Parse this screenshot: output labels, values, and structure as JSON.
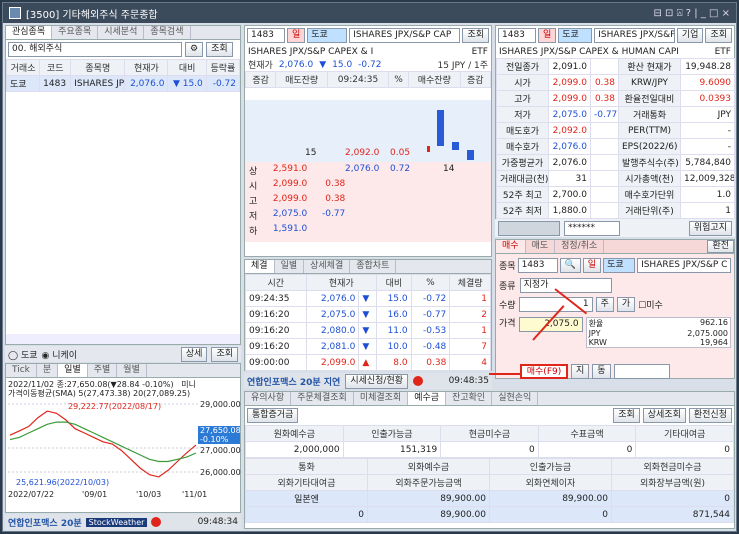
{
  "app": {
    "title": "[3500] 기타해외주식 주문종합",
    "controls": "⊟ ⊡ ⍓ ? | _ □ ×"
  },
  "left": {
    "tabs": [
      "관심종목",
      "주요종목",
      "시세분석",
      "종목검색"
    ],
    "group": "00. 해외주식",
    "search_btn": "조회",
    "cols": [
      "거래소",
      "코드",
      "종목명",
      "현재가",
      "대비",
      "등락률"
    ],
    "rows": [
      {
        "exch": "도쿄",
        "code": "1483",
        "name": "ISHARES JPX/",
        "price": "2,076.0",
        "dir": "▼",
        "diff": "15.0",
        "rate": "-0.72"
      }
    ],
    "radio1": "도쿄",
    "radio2": "니케이",
    "btn_detail": "상세",
    "btn_query": "조회",
    "chart_tabs": [
      "Tick",
      "분",
      "일별",
      "주별",
      "월별"
    ],
    "chart_info1": "2022/11/02 종:27,650.08(▼28.84 -0.10%)",
    "chart_info2": "가격이동평균(SMA) 5(27,473.38) 20(27,089.25)",
    "chart_high": "29,222.77(2022/08/17)",
    "chart_low": "25,621.96(2022/10/03)",
    "yticks": [
      "29,000.00",
      "27,000.00",
      "26,000.00"
    ],
    "ybox1": "27,650.08",
    "ybox2": "-0.10%",
    "xticks": [
      "2022/07/22",
      "'09/01",
      "'10/03",
      "'11/01"
    ],
    "chart_legend": "미니",
    "footer_brand": "연합인포맥스 20분",
    "footer_weather": "StockWeather",
    "footer_time": "09:48:34"
  },
  "chart_data": {
    "type": "line",
    "title": "가격이동평균(SMA)",
    "series": [
      {
        "name": "5",
        "values": [
          27900,
          28100,
          28300,
          28700,
          29000,
          28900,
          28600,
          28200,
          28000,
          27800,
          27600,
          27500,
          27200,
          26800,
          26400,
          26100,
          26000,
          26300,
          26700,
          27100,
          27450
        ]
      },
      {
        "name": "20",
        "values": [
          27700,
          27800,
          28000,
          28200,
          28400,
          28500,
          28500,
          28400,
          28200,
          28000,
          27800,
          27600,
          27400,
          27200,
          27000,
          26800,
          26700,
          26700,
          26800,
          26900,
          27090
        ]
      }
    ],
    "ylim": [
      25400,
      29600
    ]
  },
  "mid": {
    "code": "1483",
    "sell": "일",
    "exch": "도쿄",
    "name": "ISHARES JPX/S&P CAP",
    "btn": "조회",
    "fullname": "ISHARES JPX/S&P CAPEX & I",
    "etf": "ETF",
    "cur_label": "현재가",
    "cur_price": "2,076.0",
    "cur_dir": "▼",
    "cur_diff": "15.0",
    "cur_rate": "-0.72",
    "unit": "15 JPY / 1주",
    "hdr": [
      "증감",
      "매도잔량",
      "09:24:35",
      "%",
      "매수잔량",
      "증감"
    ],
    "ask_qty": "15",
    "ask_price": "2,092.0",
    "ask_rate": "0.05",
    "bid_price": "2,076.0",
    "bid_rate": "0.72",
    "bid_qty": "14",
    "stats": [
      {
        "k": "상",
        "v": "2,591.0",
        "r": ""
      },
      {
        "k": "시",
        "v": "2,099.0",
        "r": "0.38"
      },
      {
        "k": "고",
        "v": "2,099.0",
        "r": "0.38"
      },
      {
        "k": "저",
        "v": "2,075.0",
        "r": "-0.77"
      },
      {
        "k": "하",
        "v": "1,591.0",
        "r": ""
      }
    ],
    "ticks_tabs": [
      "체결",
      "일별",
      "상세체결",
      "종합차트"
    ],
    "tick_cols": [
      "시간",
      "현재가",
      "",
      "대비",
      "%",
      "체결량"
    ],
    "tick_rows": [
      {
        "t": "09:24:35",
        "p": "2,076.0",
        "d": "▼",
        "v": "15.0",
        "r": "-0.72",
        "q": "1"
      },
      {
        "t": "09:16:20",
        "p": "2,075.0",
        "d": "▼",
        "v": "16.0",
        "r": "-0.77",
        "q": "2"
      },
      {
        "t": "09:16:20",
        "p": "2,080.0",
        "d": "▼",
        "v": "11.0",
        "r": "-0.53",
        "q": "1"
      },
      {
        "t": "09:16:20",
        "p": "2,081.0",
        "d": "▼",
        "v": "10.0",
        "r": "-0.48",
        "q": "7"
      },
      {
        "t": "09:00:00",
        "p": "2,099.0",
        "d": "▲",
        "v": "8.0",
        "r": "0.38",
        "q": "4"
      }
    ],
    "footer_brand": "연합인포맥스 20분 지연",
    "footer_btn": "시세신청/현황",
    "footer_time": "09:48:35"
  },
  "right": {
    "code": "1483",
    "sell": "일",
    "exch": "도쿄",
    "name": "ISHARES JPX/S&P CA",
    "btn1": "기업",
    "btn2": "조회",
    "fullname": "ISHARES JPX/S&P CAPEX & HUMAN CAPI",
    "etf": "ETF",
    "info": [
      {
        "k": "전일종가",
        "v": "2,091.0",
        "v2": "",
        "k2": "환산 현재가",
        "v3": "19,948.28"
      },
      {
        "k": "시가",
        "v": "2,099.0",
        "v2": "0.38",
        "k2": "KRW/JPY",
        "v3": "9.6090"
      },
      {
        "k": "고가",
        "v": "2,099.0",
        "v2": "0.38",
        "k2": "환율전일대비",
        "v3": "0.0393"
      },
      {
        "k": "저가",
        "v": "2,075.0",
        "v2": "-0.77",
        "k2": "거래통화",
        "v3": "JPY"
      },
      {
        "k": "매도호가",
        "v": "2,092.0",
        "v2": "",
        "k2": "PER(TTM)",
        "v3": "-"
      },
      {
        "k": "매수호가",
        "v": "2,076.0",
        "v2": "",
        "k2": "EPS(2022/6)",
        "v3": "-"
      },
      {
        "k": "가중평균가",
        "v": "2,076.0",
        "v2": "",
        "k2": "발행주식수(주)",
        "v3": "5,784,840"
      },
      {
        "k": "거래대금(천)",
        "v": "31",
        "v2": "",
        "k2": "시가총액(천)",
        "v3": "12,009,328"
      },
      {
        "k": "52주 최고",
        "v": "2,700.0",
        "v2": "",
        "k2": "매수호가단위",
        "v3": "1.0"
      },
      {
        "k": "52주 최저",
        "v": "1,880.0",
        "v2": "",
        "k2": "거래단위(주)",
        "v3": "1"
      }
    ],
    "pw": "******",
    "risk_btn": "위험고지",
    "order_tabs": [
      "매수",
      "매도",
      "정정/취소"
    ],
    "exchange_btn": "환전",
    "f_code_lbl": "종목",
    "f_code": "1483",
    "f_sell": "일",
    "f_exch": "도쿄",
    "f_name": "ISHARES JPX/S&P C",
    "f_type_lbl": "종류",
    "f_type": "지정가",
    "f_qty_lbl": "수량",
    "f_qty": "1",
    "f_ju": "주",
    "f_ga": "가",
    "f_mi": "미수",
    "f_price_lbl": "가격",
    "f_price": "2,075.0",
    "rate_lbl": "환율",
    "rate_v": "962.16",
    "jpy_lbl": "JPY",
    "jpy_v": "2,075.000",
    "krw_lbl": "KRW",
    "krw_v": "19,964",
    "buy_btn": "매수(F9)",
    "ji_btn": "지",
    "dong_btn": "동"
  },
  "bottom": {
    "tabs": [
      "유의사항",
      "주문체결조회",
      "미체결조회",
      "예수금",
      "잔고확인",
      "실현손익"
    ],
    "sel": "통합증거금",
    "btn1": "조회",
    "btn2": "상세조회",
    "btn3": "환전신청",
    "h1": [
      "원화예수금",
      "인출가능금",
      "현금미수금",
      "수표금액",
      "기타대여금"
    ],
    "v1": [
      "2,000,000",
      "151,319",
      "0",
      "0",
      "0"
    ],
    "h2": [
      "통화",
      "외화예수금",
      "인출가능금",
      "외화현금미수금"
    ],
    "h3": [
      "외화기타대여금",
      "외화주문가능금액",
      "외화연체이자",
      "외화장부금액(원)"
    ],
    "v2": [
      "일본엔",
      "89,900.00",
      "89,900.00",
      "0"
    ],
    "v3": [
      "0",
      "89,900.00",
      "0",
      "871,544"
    ]
  }
}
